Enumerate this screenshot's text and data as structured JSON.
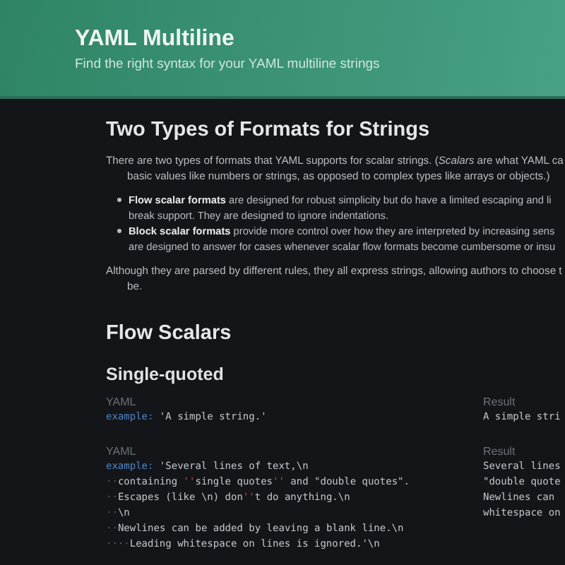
{
  "header": {
    "title": "YAML Multiline",
    "subtitle": "Find the right syntax for your YAML multiline strings"
  },
  "intro": {
    "heading": "Two Types of Formats for Strings",
    "paragraph": [
      "There are two types of formats that YAML supports for scalar strings. (*Scalars* are what YAML ca",
      "basic values like numbers or strings, as opposed to complex types like arrays or objects.)"
    ],
    "bullets": [
      [
        "**Flow scalar formats** are designed for robust simplicity but do have a limited escaping and li",
        "break support. They are designed to ignore indentations."
      ],
      [
        "**Block scalar formats** provide more control over how they are interpreted by increasing sens",
        "are designed to answer for cases whenever scalar flow formats become cumbersome or insu"
      ]
    ],
    "closing": [
      "Although they are parsed by different rules, they all express strings, allowing authors to choose t",
      "be."
    ]
  },
  "section": {
    "heading": "Flow Scalars",
    "subheading": "Single-quoted",
    "examples": [
      {
        "yaml_label": "YAML",
        "result_label": "Result",
        "code": [
          [
            {
              "kind": "key",
              "text": "example:"
            },
            {
              "kind": "str",
              "text": " 'A simple string.'"
            }
          ]
        ],
        "result": [
          "A simple stri"
        ]
      },
      {
        "yaml_label": "YAML",
        "result_label": "Result",
        "code": [
          [
            {
              "kind": "key",
              "text": "example:"
            },
            {
              "kind": "str",
              "text": " 'Several lines of text,\\n"
            }
          ],
          [
            {
              "kind": "ws",
              "text": "··"
            },
            {
              "kind": "str",
              "text": "containing "
            },
            {
              "kind": "esc",
              "text": "''"
            },
            {
              "kind": "str",
              "text": "single quotes"
            },
            {
              "kind": "esc",
              "text": "''"
            },
            {
              "kind": "str",
              "text": " and \"double quotes\"."
            }
          ],
          [
            {
              "kind": "ws",
              "text": "··"
            },
            {
              "kind": "str",
              "text": "Escapes (like \\n) don"
            },
            {
              "kind": "esc",
              "text": "''"
            },
            {
              "kind": "str",
              "text": "t do anything.\\n"
            }
          ],
          [
            {
              "kind": "ws",
              "text": "··"
            },
            {
              "kind": "str",
              "text": "\\n"
            }
          ],
          [
            {
              "kind": "ws",
              "text": "··"
            },
            {
              "kind": "str",
              "text": "Newlines can be added by leaving a blank line.\\n"
            }
          ],
          [
            {
              "kind": "ws",
              "text": "····"
            },
            {
              "kind": "str",
              "text": "Leading whitespace on lines is ignored.'\\n"
            }
          ]
        ],
        "result": [
          "Several lines",
          "\"double quote",
          "Newlines can",
          "whitespace on"
        ]
      }
    ]
  }
}
